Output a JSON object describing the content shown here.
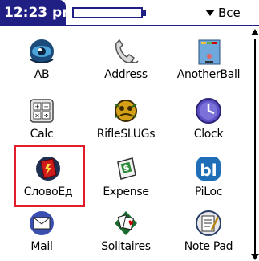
{
  "statusbar": {
    "time": "12:23 pm",
    "category": "Все"
  },
  "colors": {
    "titlebar": "#1f1f84",
    "selection": "#e21c2a"
  },
  "apps": [
    {
      "label": "AB",
      "icon": "ab-icon"
    },
    {
      "label": "Address",
      "icon": "address-phone-icon"
    },
    {
      "label": "AnotherBall",
      "icon": "anotherball-icon"
    },
    {
      "label": "Calc",
      "icon": "calculator-icon"
    },
    {
      "label": "RifleSLUGs",
      "icon": "rifleslugs-icon"
    },
    {
      "label": "Clock",
      "icon": "clock-icon"
    },
    {
      "label": "СловоЕд",
      "icon": "slovoed-book-icon"
    },
    {
      "label": "Expense",
      "icon": "expense-icon"
    },
    {
      "label": "PiLoc",
      "icon": "piloc-icon"
    },
    {
      "label": "Mail",
      "icon": "mail-icon"
    },
    {
      "label": "Solitaires",
      "icon": "solitaires-icon"
    },
    {
      "label": "Note Pad",
      "icon": "notepad-icon"
    }
  ],
  "selected_app": "СловоЕд"
}
